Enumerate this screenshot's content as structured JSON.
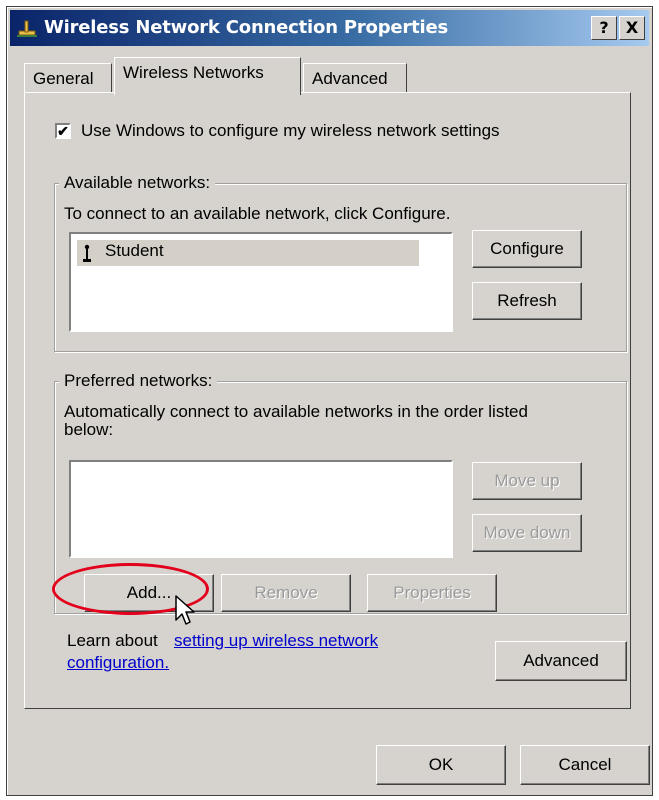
{
  "window": {
    "title": "Wireless Network Connection Properties",
    "help_glyph": "?",
    "close_glyph": "X"
  },
  "tabs": [
    {
      "label": "General",
      "active": false
    },
    {
      "label": "Wireless Networks",
      "active": true
    },
    {
      "label": "Advanced",
      "active": false
    }
  ],
  "use_windows": {
    "checked": true,
    "check_glyph": "✔",
    "label": "Use Windows to configure my wireless network settings"
  },
  "available": {
    "legend": "Available networks:",
    "description": "To connect to an available network, click Configure.",
    "networks": [
      {
        "icon": "wireless-antenna-icon",
        "name": "Student",
        "selected": true
      }
    ],
    "configure_label": "Configure",
    "refresh_label": "Refresh"
  },
  "preferred": {
    "legend": "Preferred networks:",
    "description_line1": "Automatically connect to available networks in the order listed",
    "description_line2": "below:",
    "move_up_label": "Move up",
    "move_down_label": "Move down",
    "add_label": "Add...",
    "remove_label": "Remove",
    "properties_label": "Properties"
  },
  "learn": {
    "prefix": "Learn about",
    "link_line1": "setting up wireless network",
    "link_line2": "configuration.",
    "advanced_label": "Advanced"
  },
  "footer": {
    "ok_label": "OK",
    "cancel_label": "Cancel"
  },
  "colors": {
    "dialog_bg": "#d6d3ce",
    "title_start": "#0a246a",
    "title_end": "#a6caf0",
    "link": "#0000cc",
    "highlight_ellipse": "#e3001b"
  }
}
